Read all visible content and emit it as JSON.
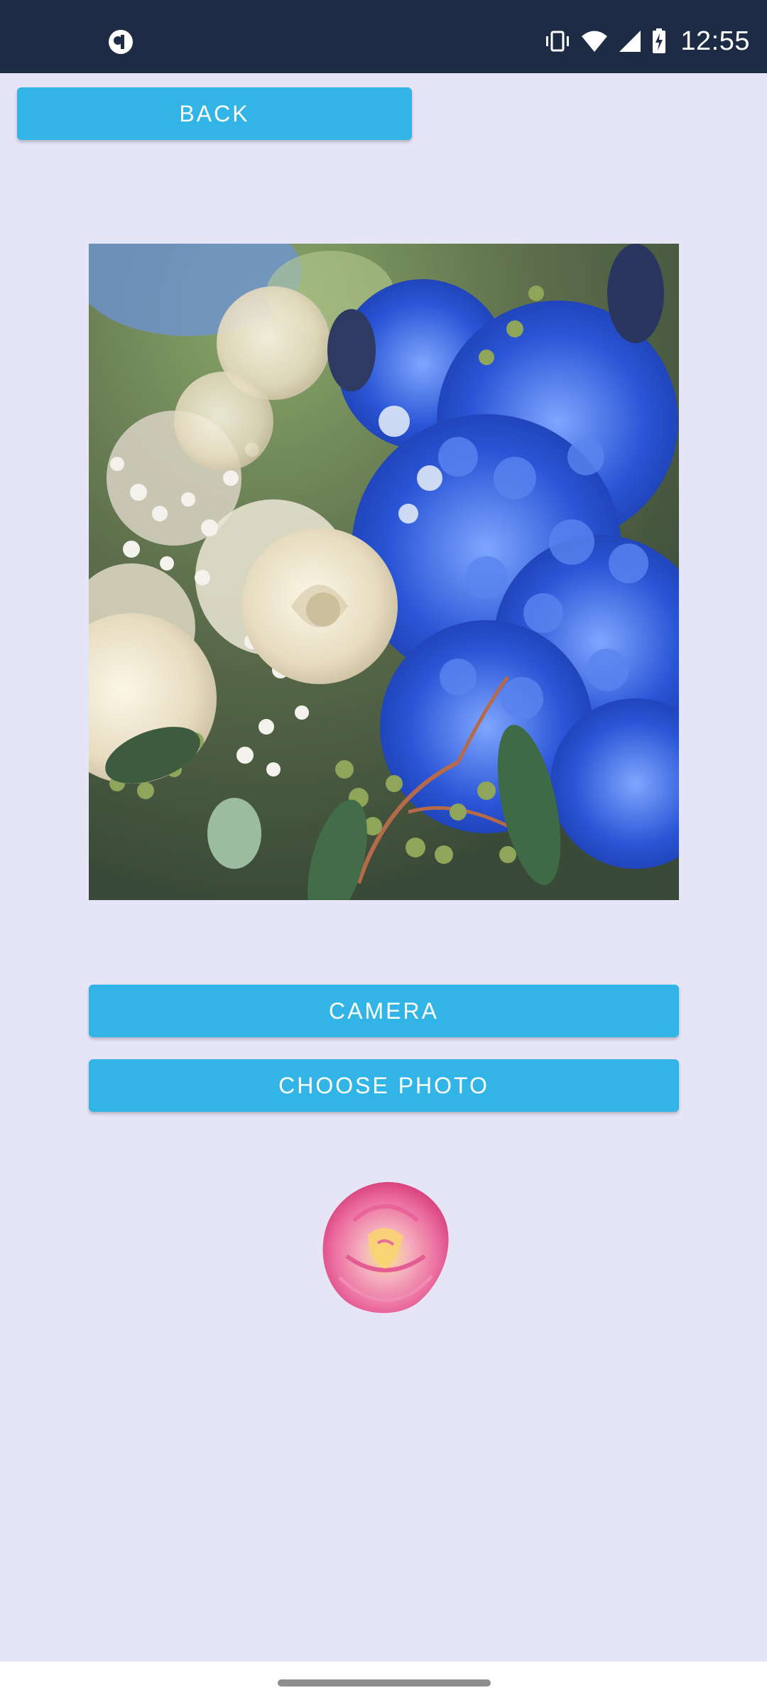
{
  "status_bar": {
    "time": "12:55",
    "left_icon": "pocket-app-icon",
    "right_icons": [
      "vibrate-icon",
      "wifi-icon",
      "signal-icon",
      "battery-charging-icon"
    ]
  },
  "buttons": {
    "back_label": "BACK",
    "camera_label": "CAMERA",
    "choose_photo_label": "CHOOSE PHOTO"
  },
  "images": {
    "main_photo": "flower-bouquet-photo",
    "small_flower": "pink-rose-image"
  },
  "colors": {
    "status_bar_bg": "#1d2c44",
    "page_bg": "#e6e5f8",
    "accent_button": "#32b5e6"
  }
}
